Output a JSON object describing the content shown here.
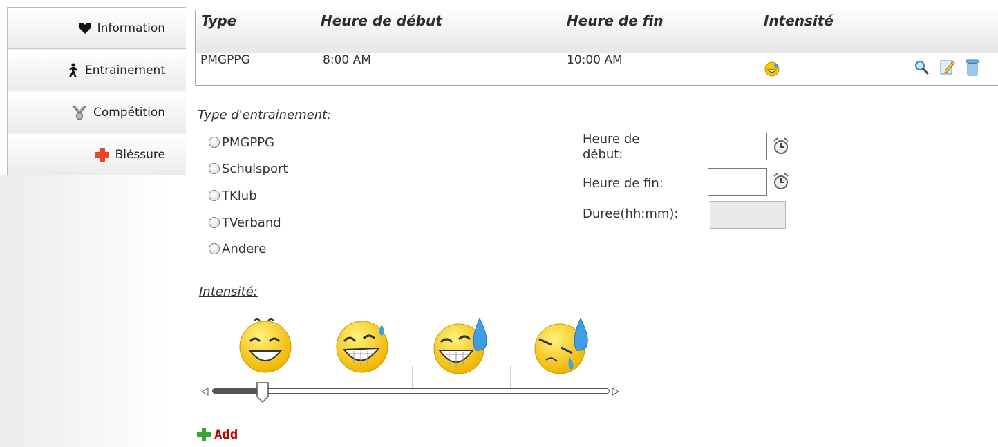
{
  "sidebar": {
    "items": [
      {
        "label": "Information",
        "icon": "heart-icon"
      },
      {
        "label": "Entrainement",
        "icon": "runner-icon"
      },
      {
        "label": "Compétition",
        "icon": "medal-icon"
      },
      {
        "label": "Bléssure",
        "icon": "red-cross-icon"
      }
    ]
  },
  "table": {
    "headers": [
      "Type",
      "Heure de début",
      "Heure de fin",
      "Intensité"
    ],
    "rows": [
      {
        "type": "PMGPPG",
        "start": "8:00 AM",
        "end": "10:00 AM",
        "intensity_icon": "smiley-icon"
      }
    ],
    "row_actions": [
      "view-icon",
      "edit-icon",
      "delete-icon"
    ]
  },
  "form": {
    "training_type_label": "Type d'entrainement:",
    "training_types": [
      "PMGPPG",
      "Schulsport",
      "TKlub",
      "TVerband",
      "Andere"
    ],
    "start_label_line1": "Heure de",
    "start_label_line2": "début:",
    "end_label": "Heure de fin:",
    "duration_label": "Duree(hh:mm):",
    "start_value": "",
    "end_value": "",
    "duration_value": "",
    "intensity_label": "Intensité:",
    "intensity_level": 1,
    "intensity_levels": 4,
    "add_label": "Add"
  },
  "colors": {
    "accent_red": "#c00000",
    "add_green": "#3aa335",
    "smiley_yellow": "#f7c600",
    "tear_blue": "#3f9ee6"
  }
}
